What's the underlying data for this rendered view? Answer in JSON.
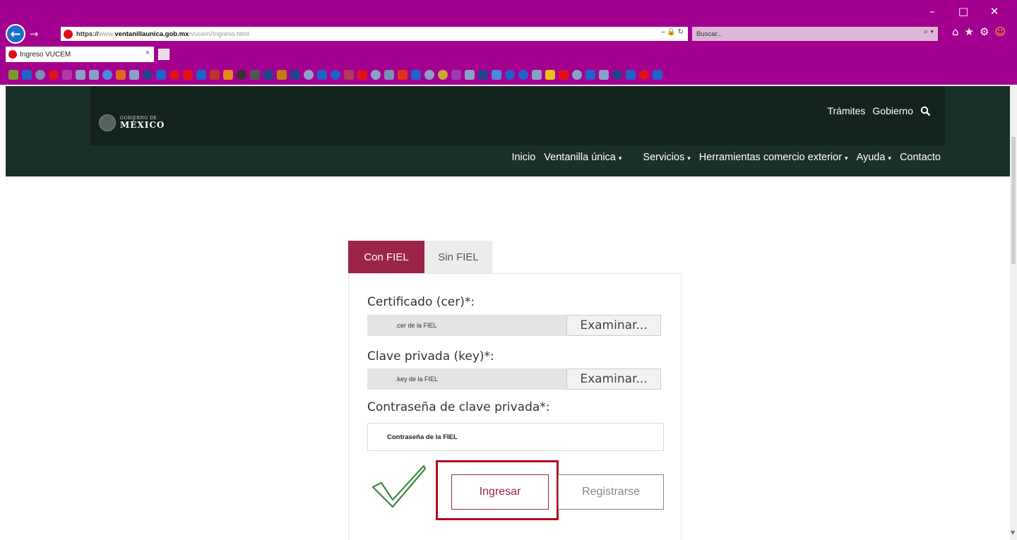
{
  "browser": {
    "url_proto": "https://",
    "url_prefix": "www.",
    "url_domain": "ventanillaunica.gob.mx",
    "url_path": "/vucem/Ingreso.html",
    "url_tools": "– 🔒 ↻",
    "search_placeholder": "Buscar...",
    "search_tools": "⌕ ▾",
    "tab_title": "Ingreso VUCEM",
    "tab_close": "×",
    "window_controls": [
      "–",
      "□",
      "✕"
    ],
    "back_glyph": "←",
    "forward_glyph": "→",
    "icons": [
      "⌂",
      "★",
      "⚙",
      "☺"
    ],
    "favorites_colors": [
      "#7a9c2e",
      "#1f62c8",
      "#7a8fb1",
      "#e0101a",
      "#b23aa8",
      "#8aa0c8",
      "#8aa0c8",
      "#4b8ae0",
      "#e06a1a",
      "#8aa0c8",
      "#24448f",
      "#1f62c8",
      "#e0101a",
      "#e0101a",
      "#1f62c8",
      "#c03030",
      "#e08a1a",
      "#333333",
      "#555555",
      "#24448f",
      "#c47b14",
      "#24448f",
      "#8aa0c8",
      "#1f62c8",
      "#1f62c8",
      "#b03a5a",
      "#e0101a",
      "#8aa0c8",
      "#7a8fb1",
      "#e0341a",
      "#1f62c8",
      "#8aa0c8",
      "#c8a43a",
      "#9c3ab1",
      "#8aa0c8",
      "#24448f",
      "#4b8ae0",
      "#1f62c8",
      "#1f62c8",
      "#8aa0c8",
      "#e8c21a",
      "#e0101a",
      "#8aa0c8",
      "#1f62c8",
      "#8aa0c8",
      "#24448f",
      "#1f62c8",
      "#e0101a",
      "#1f62c8"
    ]
  },
  "site": {
    "logo_small": "GOBIERNO DE",
    "logo_big": "MÉXICO",
    "top_links": [
      "Trámites",
      "Gobierno"
    ],
    "nav": [
      {
        "label": "Inicio",
        "caret": ""
      },
      {
        "label": "Ventanilla única",
        "caret": "▾"
      },
      {
        "label": "Servicios",
        "caret": "▾"
      },
      {
        "label": "Herramientas comercio exterior",
        "caret": "▾"
      },
      {
        "label": "Ayuda",
        "caret": "▾"
      },
      {
        "label": "Contacto",
        "caret": ""
      }
    ]
  },
  "login": {
    "tabs": [
      "Con FIEL",
      "Sin FIEL"
    ],
    "cert_label": "Certificado (cer)*:",
    "cert_value": ".cer de la FIEL",
    "key_label": "Clave privada (key)*:",
    "key_value": ".key de la FIEL",
    "browse_label": "Examinar...",
    "password_label": "Contraseña de clave privada*:",
    "password_value": "Contraseña de la FIEL",
    "ingresar_label": "Ingresar",
    "registrarse_label": "Registrarse"
  },
  "colors": {
    "browser_chrome": "#a4008f",
    "header_bg": "#1a302a",
    "accent": "#9d2449",
    "highlight": "#b10e1d",
    "checkmark": "#3e8a3e"
  }
}
